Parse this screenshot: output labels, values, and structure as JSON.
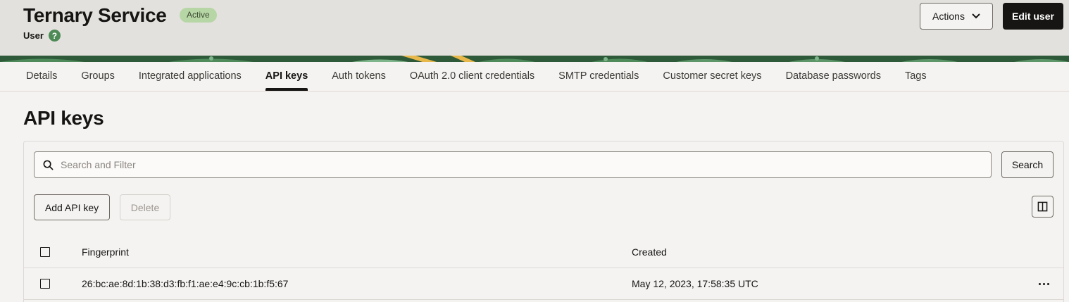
{
  "header": {
    "title": "Ternary Service",
    "status": "Active",
    "subtitle": "User",
    "help_glyph": "?",
    "actions_label": "Actions",
    "edit_label": "Edit user"
  },
  "tabs": [
    {
      "label": "Details"
    },
    {
      "label": "Groups"
    },
    {
      "label": "Integrated applications"
    },
    {
      "label": "API keys",
      "active": true
    },
    {
      "label": "Auth tokens"
    },
    {
      "label": "OAuth 2.0 client credentials"
    },
    {
      "label": "SMTP credentials"
    },
    {
      "label": "Customer secret keys"
    },
    {
      "label": "Database passwords"
    },
    {
      "label": "Tags"
    }
  ],
  "main": {
    "page_title": "API keys",
    "search": {
      "placeholder": "Search and Filter",
      "value": "",
      "button_label": "Search"
    },
    "add_label": "Add API key",
    "delete_label": "Delete",
    "columns": {
      "fingerprint": "Fingerprint",
      "created": "Created"
    },
    "rows": [
      {
        "fingerprint": "26:bc:ae:8d:1b:38:d3:fb:f1:ae:e4:9c:cb:1b:f5:67",
        "created": "May 12, 2023, 17:58:35 UTC"
      }
    ]
  },
  "icons": {
    "help": "help-circle-icon",
    "actions_chevron": "chevron-down-icon",
    "search": "search-icon",
    "columns": "columns-icon",
    "row_menu": "more-horizontal-icon"
  },
  "colors": {
    "status_badge": "#b7d6a5",
    "help_icon": "#4e8a56",
    "banner": "#2e5a3a",
    "primary_button": "#161513"
  }
}
